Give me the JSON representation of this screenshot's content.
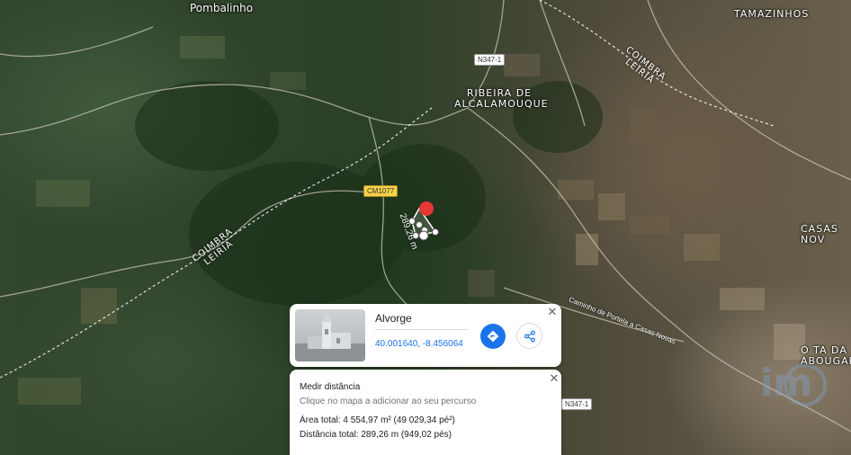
{
  "map": {
    "type": "satellite",
    "places": {
      "pombalinho": "Pombalinho",
      "tamazinhos": "TAMAZINHOS",
      "ribeira_line1": "RIBEIRA DE",
      "ribeira_line2": "ALCALAMOUQUE",
      "casas_novas": "CASAS NOV",
      "ota_line1": "O TA DA",
      "ota_line2": "ABOUGAR"
    },
    "trails": {
      "coimbra_ne": "COIMBRA",
      "leiria_ne": "LEIRIA",
      "coimbra_sw": "COIMBRA",
      "leiria_sw": "LEIRIA"
    },
    "roads": {
      "n347_1": "N347-1",
      "cm1077": "CM1077",
      "n347_1_lower": "N347-1",
      "caminho": "Caminho de Portela a Casas Novas"
    },
    "measure_label": "289,26 m",
    "colors": {
      "measure_line": "#ffffff",
      "pin": "#e53935"
    }
  },
  "place_card": {
    "title": "Alvorge",
    "coords": "40.001640, -8.456064",
    "directions_icon": "directions-icon",
    "share_icon": "share-icon",
    "close": "✕",
    "accent": "#1a73e8"
  },
  "measure_card": {
    "title": "Medir distância",
    "hint": "Clique no mapa a adicionar ao seu percurso",
    "area": "Área total: 4 554,97 m² (49 029,34 pé²)",
    "distance": "Distância total: 289,26 m (949,02 pés)",
    "close": "✕"
  }
}
